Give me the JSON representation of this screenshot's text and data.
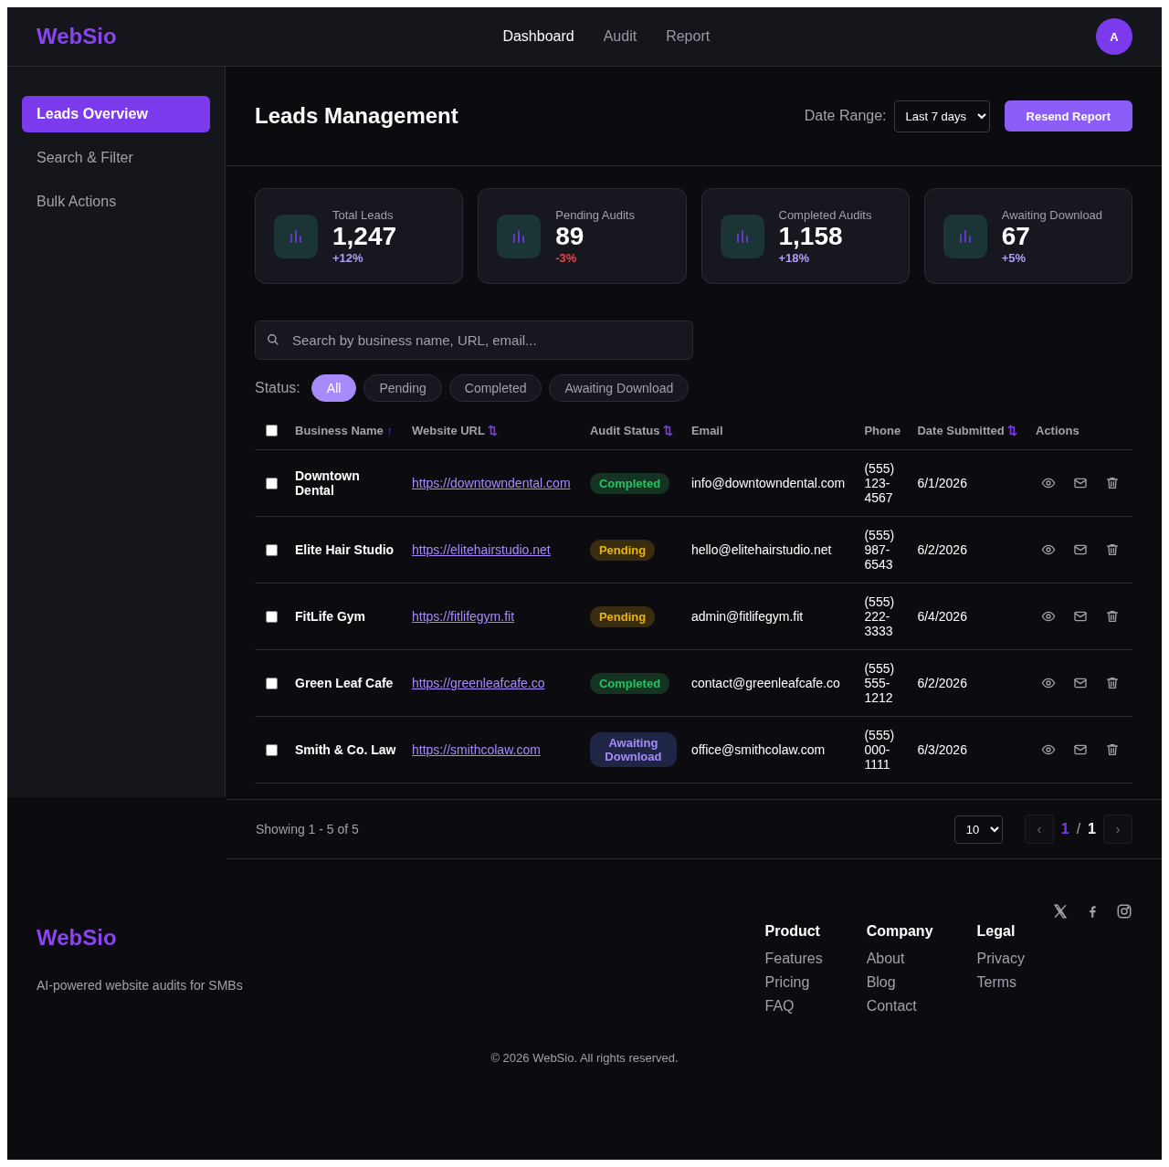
{
  "header": {
    "logo": "WebSio",
    "nav": [
      {
        "label": "Dashboard",
        "selected": true
      },
      {
        "label": "Audit",
        "selected": false
      },
      {
        "label": "Report",
        "selected": false
      }
    ],
    "avatar": "A"
  },
  "sidebar": {
    "items": [
      {
        "label": "Leads Overview",
        "selected": true
      },
      {
        "label": "Search & Filter",
        "selected": false
      },
      {
        "label": "Bulk Actions",
        "selected": false
      }
    ]
  },
  "page": {
    "title": "Leads Management",
    "date_range_label": "Date Range:",
    "date_range_value": "Last 7 days",
    "resend_button": "Resend Report"
  },
  "stats": [
    {
      "label": "Total Leads",
      "value": "1,247",
      "change": "+12%",
      "kind": "up"
    },
    {
      "label": "Pending Audits",
      "value": "89",
      "change": "-3%",
      "kind": "down"
    },
    {
      "label": "Completed Audits",
      "value": "1,158",
      "change": "+18%",
      "kind": "up"
    },
    {
      "label": "Awaiting Download",
      "value": "67",
      "change": "+5%",
      "kind": "up"
    }
  ],
  "search": {
    "placeholder": "Search by business name, URL, email..."
  },
  "status_filter": {
    "label": "Status:",
    "options": [
      {
        "label": "All",
        "selected": true
      },
      {
        "label": "Pending",
        "selected": false
      },
      {
        "label": "Completed",
        "selected": false
      },
      {
        "label": "Awaiting Download",
        "selected": false
      }
    ]
  },
  "table": {
    "select_all_checked": false,
    "columns": [
      {
        "label": "Business Name",
        "sort_icon": "↑"
      },
      {
        "label": "Website URL",
        "sort_icon": "⇅"
      },
      {
        "label": "Audit Status",
        "sort_icon": "⇅"
      },
      {
        "label": "Email"
      },
      {
        "label": "Phone"
      },
      {
        "label": "Date Submitted",
        "sort_icon": "⇅"
      },
      {
        "label": "Actions"
      }
    ],
    "rows": [
      {
        "checked": false,
        "business": "Downtown Dental",
        "url": "https://downtowndental.com",
        "status": "Completed",
        "kind": "completed",
        "email": "info@downtowndental.com",
        "phone": "(555) 123-4567",
        "date": "6/1/2026"
      },
      {
        "checked": false,
        "business": "Elite Hair Studio",
        "url": "https://elitehairstudio.net",
        "status": "Pending",
        "kind": "pending",
        "email": "hello@elitehairstudio.net",
        "phone": "(555) 987-6543",
        "date": "6/2/2026"
      },
      {
        "checked": false,
        "business": "FitLife Gym",
        "url": "https://fitlifegym.fit",
        "status": "Pending",
        "kind": "pending",
        "email": "admin@fitlifegym.fit",
        "phone": "(555) 222-3333",
        "date": "6/4/2026"
      },
      {
        "checked": false,
        "business": "Green Leaf Cafe",
        "url": "https://greenleafcafe.co",
        "status": "Completed",
        "kind": "completed",
        "email": "contact@greenleafcafe.co",
        "phone": "(555) 555-1212",
        "date": "6/2/2026"
      },
      {
        "checked": false,
        "business": "Smith & Co. Law",
        "url": "https://smithcolaw.com",
        "status": "Awaiting Download",
        "kind": "awaiting",
        "email": "office@smithcolaw.com",
        "phone": "(555) 000-1111",
        "date": "6/3/2026"
      }
    ]
  },
  "pagination": {
    "summary": "Showing 1 - 5 of 5",
    "page_size": "10",
    "prev": "‹",
    "current": "1",
    "separator": "/",
    "total": "1",
    "next": "›"
  },
  "footer": {
    "logo": "WebSio",
    "tagline": "AI-powered website audits for SMBs",
    "columns": [
      {
        "title": "Product",
        "links": [
          "Features",
          "Pricing",
          "FAQ"
        ]
      },
      {
        "title": "Company",
        "links": [
          "About",
          "Blog",
          "Contact"
        ]
      },
      {
        "title": "Legal",
        "links": [
          "Privacy",
          "Terms"
        ]
      }
    ],
    "copyright": "© 2026 WebSio. All rights reserved."
  }
}
